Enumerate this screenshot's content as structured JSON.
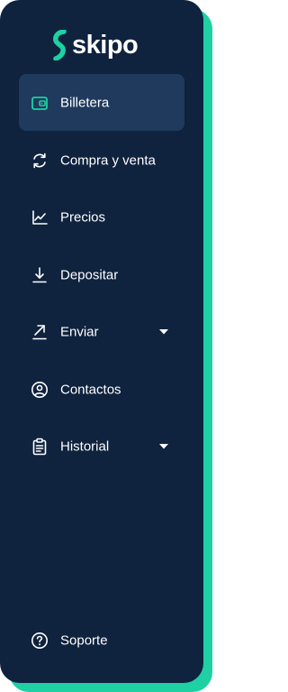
{
  "brand": {
    "name": "skipo"
  },
  "colors": {
    "panel": "#0f223e",
    "accent": "#1fd0a3",
    "active_bg": "#1f3a5c",
    "text": "#ffffff"
  },
  "nav": {
    "items": [
      {
        "label": "Billetera",
        "icon": "wallet-icon",
        "active": true
      },
      {
        "label": "Compra y venta",
        "icon": "refresh-icon"
      },
      {
        "label": "Precios",
        "icon": "chart-icon"
      },
      {
        "label": "Depositar",
        "icon": "download-icon"
      },
      {
        "label": "Enviar",
        "icon": "arrow-up-right-icon",
        "has_dropdown": true
      },
      {
        "label": "Contactos",
        "icon": "user-circle-icon"
      },
      {
        "label": "Historial",
        "icon": "clipboard-icon",
        "has_dropdown": true
      }
    ],
    "footer": {
      "label": "Soporte",
      "icon": "help-circle-icon"
    }
  }
}
